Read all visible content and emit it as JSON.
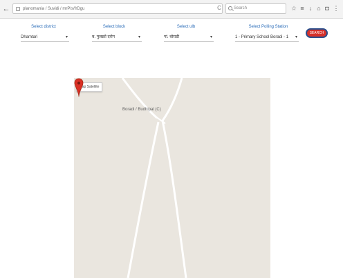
{
  "browser": {
    "url": "planomania / Suvidi / mrP/s/frDgu",
    "search_placeholder": "Search",
    "nav_back": "←",
    "nav_info": "ⓘ",
    "reload": "C"
  },
  "filters": [
    {
      "label": "Select district",
      "value": "Dhamtari"
    },
    {
      "label": "Select block",
      "value": "ब. फुक्क्रो दरोग"
    },
    {
      "label": "Select ulb",
      "value": "गां. बोराडी"
    },
    {
      "label": "Select Polling Station",
      "value": "1 - Primary School Boradi - 1"
    }
  ],
  "search_button": {
    "label": "SEARCH"
  },
  "map": {
    "type_button": "Map Satellite",
    "place_label": "Boradi / Budhipal (C)",
    "colors": {
      "land": "#eae6df",
      "road": "#ffffff",
      "marker": "#d93025"
    }
  },
  "icons": {
    "back": "arrow-left-icon",
    "info": "info-icon",
    "lock": "lock-icon",
    "reload": "reload-icon",
    "search": "search-icon",
    "bookmark_star": "star-icon",
    "reading_list": "list-icon",
    "download": "download-icon",
    "home": "home-icon",
    "pocket": "pocket-icon",
    "menu": "menu-icon",
    "marker": "map-marker-icon"
  }
}
